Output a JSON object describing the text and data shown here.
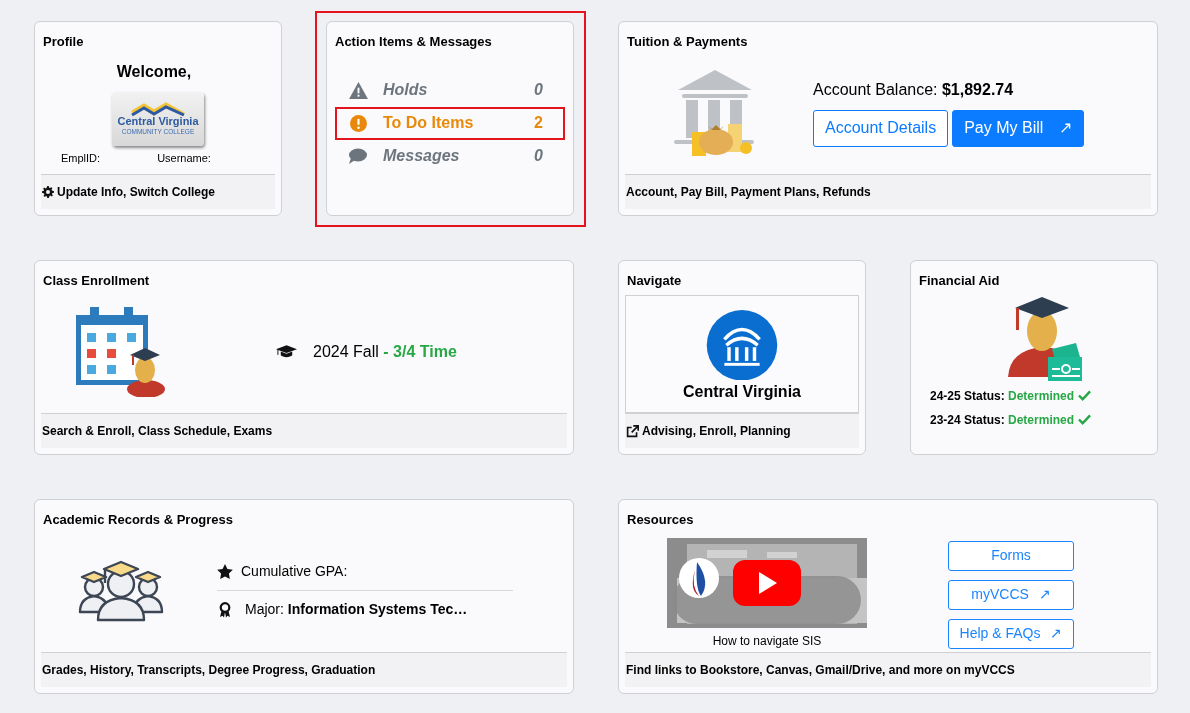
{
  "cards": [
    {
      "kind": "profile",
      "title": "Profile",
      "highlighted": false,
      "welcome": "Welcome,",
      "logo": {
        "name": "Central Virginia",
        "subtitle": "COMMUNITY COLLEGE"
      },
      "fields": [
        "EmplID:",
        "Username:"
      ],
      "footer": "Update Info, Switch College"
    },
    {
      "kind": "actions",
      "title": "Action Items & Messages",
      "highlighted": true,
      "items": [
        {
          "kind": "warning",
          "label": "Holds",
          "count": "0",
          "active": false,
          "highlighted": false
        },
        {
          "kind": "alert",
          "label": "To Do Items",
          "count": "2",
          "active": true,
          "highlighted": true
        },
        {
          "kind": "chat",
          "label": "Messages",
          "count": "0",
          "active": false,
          "highlighted": false
        }
      ]
    },
    {
      "kind": "tuition",
      "title": "Tuition & Payments",
      "highlighted": false,
      "balance_label": "Account Balance:",
      "balance": "$1,892.74",
      "buttons": [
        {
          "label": "Account Details",
          "kind": "outline"
        },
        {
          "label": "Pay My Bill",
          "kind": "primary",
          "arrow": "↗"
        }
      ],
      "footer": "Account, Pay Bill, Payment Plans, Refunds"
    },
    {
      "kind": "enrollment",
      "title": "Class Enrollment",
      "highlighted": false,
      "term": "2024 Fall",
      "load": "- 3/4 Time",
      "footer": "Search & Enroll, Class Schedule, Exams"
    },
    {
      "kind": "navigate",
      "title": "Navigate",
      "highlighted": false,
      "school": "Central Virginia",
      "footer": "Advising, Enroll, Planning"
    },
    {
      "kind": "aid",
      "title": "Financial Aid",
      "highlighted": false,
      "statuses": [
        {
          "label": "24-25 Status:",
          "value": "Determined",
          "complete": true
        },
        {
          "label": "23-24 Status:",
          "value": "Determined",
          "complete": true
        }
      ]
    },
    {
      "kind": "academic",
      "title": "Academic Records & Progress",
      "highlighted": false,
      "gpa_label": "Cumulative GPA:",
      "major_label": "Major:",
      "major": "Information Systems Tec…",
      "footer": "Grades, History, Transcripts, Degree Progress, Graduation"
    },
    {
      "kind": "resources",
      "title": "Resources",
      "highlighted": false,
      "video_caption": "How to navigate SIS",
      "links": [
        {
          "label": "Forms"
        },
        {
          "label": "myVCCS",
          "arrow": "↗"
        },
        {
          "label": "Help & FAQs",
          "arrow": "↗"
        }
      ],
      "footer": "Find links to Bookstore, Canvas, Gmail/Drive, and more on myVCCS"
    }
  ]
}
